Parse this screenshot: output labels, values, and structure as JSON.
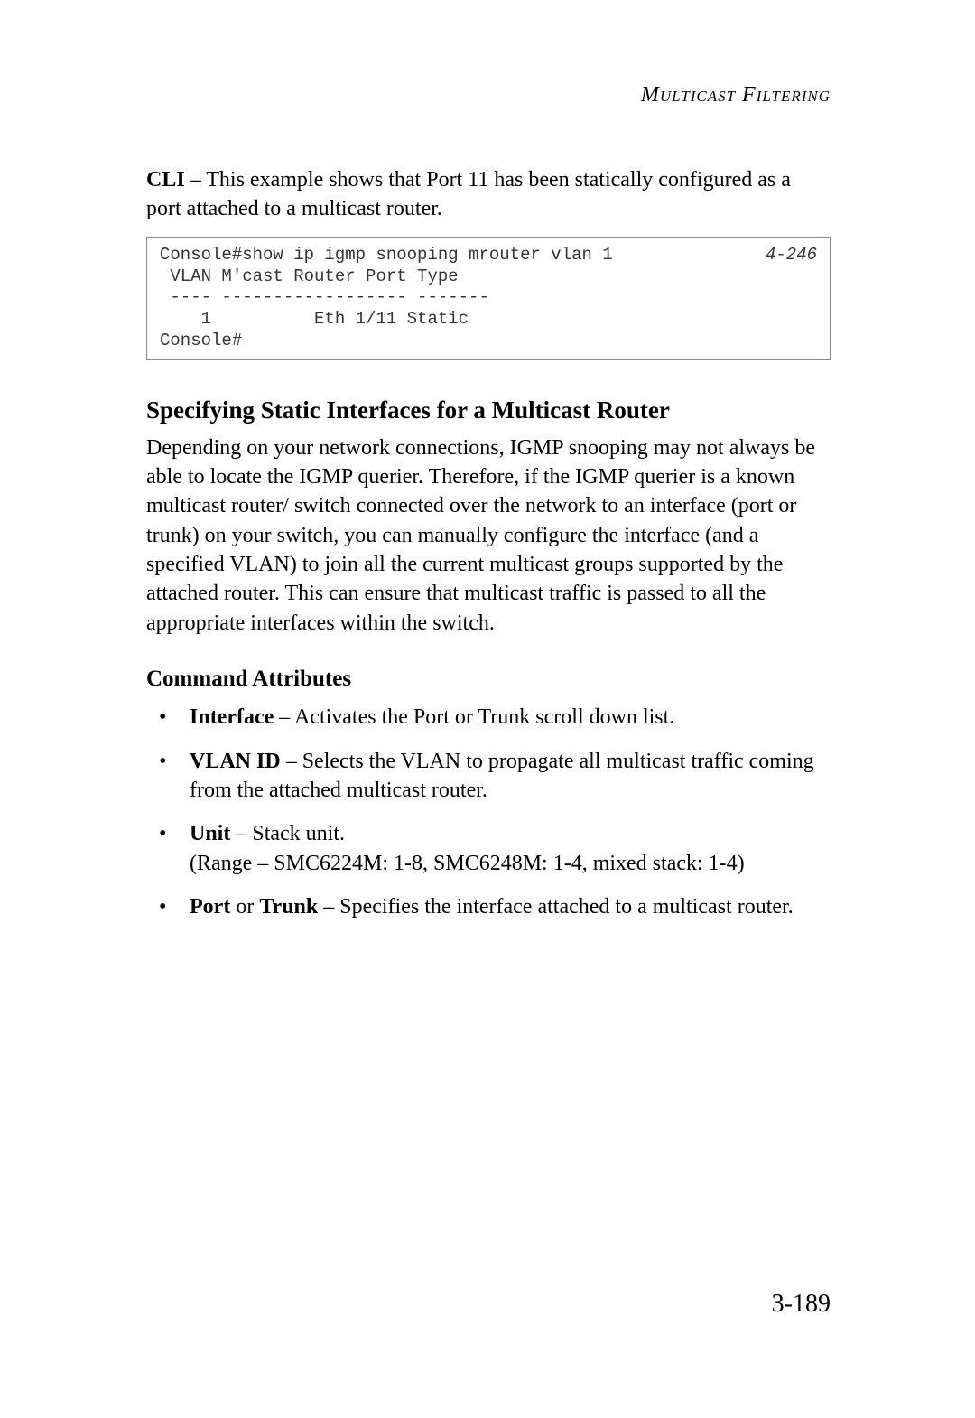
{
  "running_head": "Multicast Filtering",
  "intro": {
    "lead": "CLI",
    "text": " – This example shows that Port 11 has been statically configured as a port attached to a multicast router."
  },
  "code": {
    "body": "Console#show ip igmp snooping mrouter vlan 1\n VLAN M'cast Router Port Type\n ---- ------------------ -------\n    1          Eth 1/11 Static\nConsole#",
    "page_ref": "4-246"
  },
  "section_title": "Specifying Static Interfaces for a Multicast Router",
  "section_body": "Depending on your network connections, IGMP snooping may not always be able to locate the IGMP querier. Therefore, if the IGMP querier is a known multicast router/ switch connected over the network to an interface (port or trunk) on your switch, you can manually configure the interface (and a specified VLAN) to join all the current multicast groups supported by the attached router. This can ensure that multicast traffic is passed to all the appropriate interfaces within the switch.",
  "attrs_title": "Command Attributes",
  "attrs": [
    {
      "term": "Interface",
      "desc": " – Activates the Port or Trunk scroll down list."
    },
    {
      "term": "VLAN ID",
      "desc": " – Selects the VLAN to propagate all multicast traffic coming from the attached multicast router."
    },
    {
      "term": "Unit",
      "desc": " – Stack unit.",
      "extra": "(Range – SMC6224M: 1-8, SMC6248M: 1-4, mixed stack: 1-4)"
    },
    {
      "term": "Port",
      "mid": " or ",
      "term2": "Trunk",
      "desc": " – Specifies the interface attached to a multicast router."
    }
  ],
  "page_number": "3-189"
}
